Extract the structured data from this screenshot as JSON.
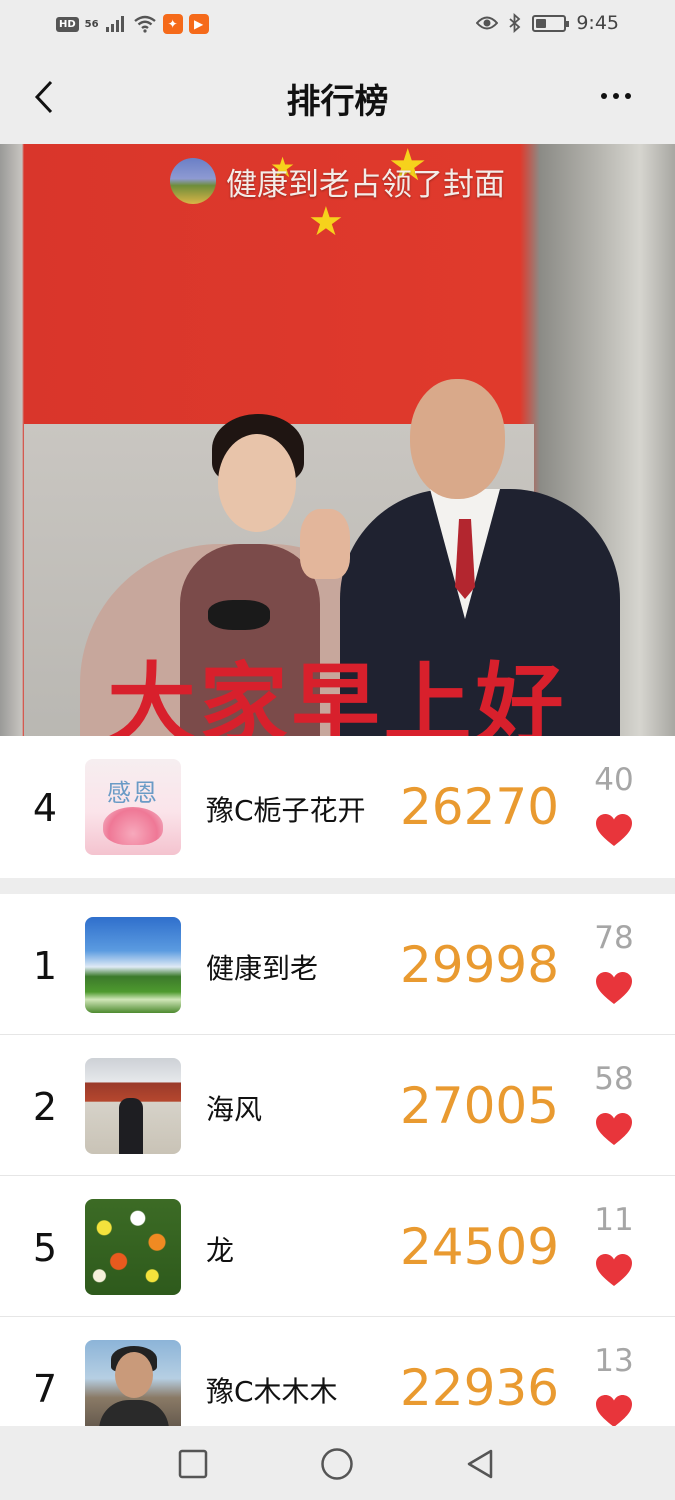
{
  "status_bar": {
    "left_badges": [
      "HD",
      "56"
    ],
    "icons": [
      "signal-icon",
      "wifi-icon",
      "app-icon-orange",
      "video-app-icon",
      "eye-icon",
      "bluetooth-icon",
      "battery-icon"
    ],
    "battery_level": 0.4,
    "time": "9:45"
  },
  "nav": {
    "title": "排行榜",
    "back_icon": "chevron-left-icon",
    "more_icon": "more-dots-icon"
  },
  "cover": {
    "caption": "健康到老占领了封面",
    "greeting": "大家早上好"
  },
  "my_rank": {
    "rank": "4",
    "avatar_text": "感恩",
    "name": "豫C栀子花开",
    "steps": "26270",
    "likes": "40"
  },
  "ranking": [
    {
      "rank": "1",
      "name": "健康到老",
      "steps": "29998",
      "likes": "78"
    },
    {
      "rank": "2",
      "name": "海风",
      "steps": "27005",
      "likes": "58"
    },
    {
      "rank": "5",
      "name": "龙",
      "steps": "24509",
      "likes": "11"
    },
    {
      "rank": "7",
      "name": "豫C木木木",
      "steps": "22936",
      "likes": "13"
    }
  ],
  "colors": {
    "steps": "#e99a30",
    "heart": "#e8353b",
    "likes": "#a6a6a6",
    "background": "#ededed"
  },
  "system_nav": {
    "icons": [
      "square-recent-icon",
      "circle-home-icon",
      "triangle-back-icon"
    ]
  }
}
